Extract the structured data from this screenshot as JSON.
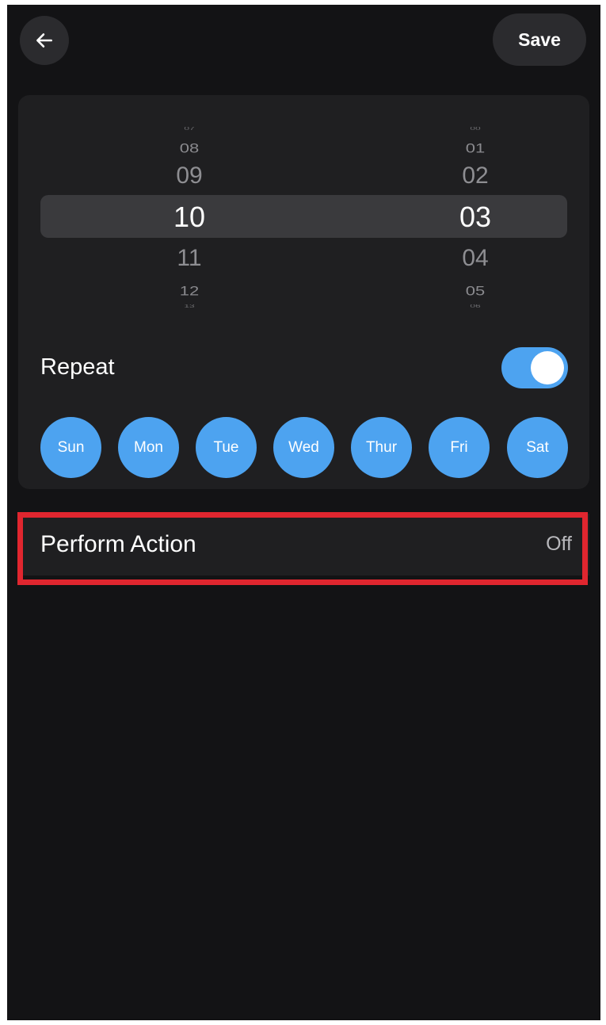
{
  "header": {
    "back_icon": "arrow-left-icon",
    "save_label": "Save"
  },
  "time_picker": {
    "hours": {
      "fade_top": "07",
      "far_top": "08",
      "near_top": "09",
      "selected": "10",
      "near_bottom": "11",
      "far_bottom": "12",
      "fade_bottom": "13"
    },
    "minutes": {
      "fade_top": "00",
      "far_top": "01",
      "near_top": "02",
      "selected": "03",
      "near_bottom": "04",
      "far_bottom": "05",
      "fade_bottom": "06"
    }
  },
  "repeat": {
    "label": "Repeat",
    "enabled": true
  },
  "days": [
    {
      "label": "Sun",
      "selected": true
    },
    {
      "label": "Mon",
      "selected": true
    },
    {
      "label": "Tue",
      "selected": true
    },
    {
      "label": "Wed",
      "selected": true
    },
    {
      "label": "Thur",
      "selected": true
    },
    {
      "label": "Fri",
      "selected": true
    },
    {
      "label": "Sat",
      "selected": true
    }
  ],
  "perform_action": {
    "label": "Perform Action",
    "value": "Off"
  },
  "colors": {
    "background": "#131315",
    "card": "#1f1f21",
    "accent": "#4da3f0",
    "highlight_outline": "#e0262f"
  }
}
